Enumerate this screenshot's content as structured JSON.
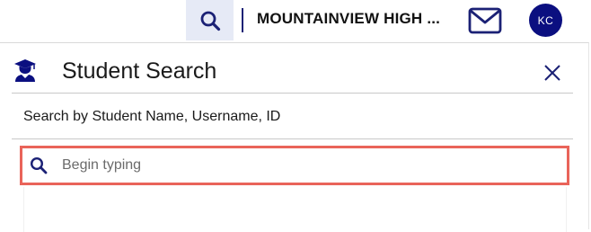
{
  "header": {
    "school_name": "MOUNTAINVIEW HIGH ...",
    "avatar_initials": "KC",
    "search_icon": "search-icon",
    "mail_icon": "mail-icon"
  },
  "panel": {
    "icon": "student-graduate-icon",
    "title": "Student Search",
    "subtitle": "Search by Student Name, Username, ID",
    "close_icon": "close-icon",
    "search": {
      "placeholder": "Begin typing",
      "value": ""
    }
  },
  "colors": {
    "brand_navy": "#0b0f80",
    "active_bg": "#e6eaf6",
    "focus_outline": "#e9645a"
  }
}
